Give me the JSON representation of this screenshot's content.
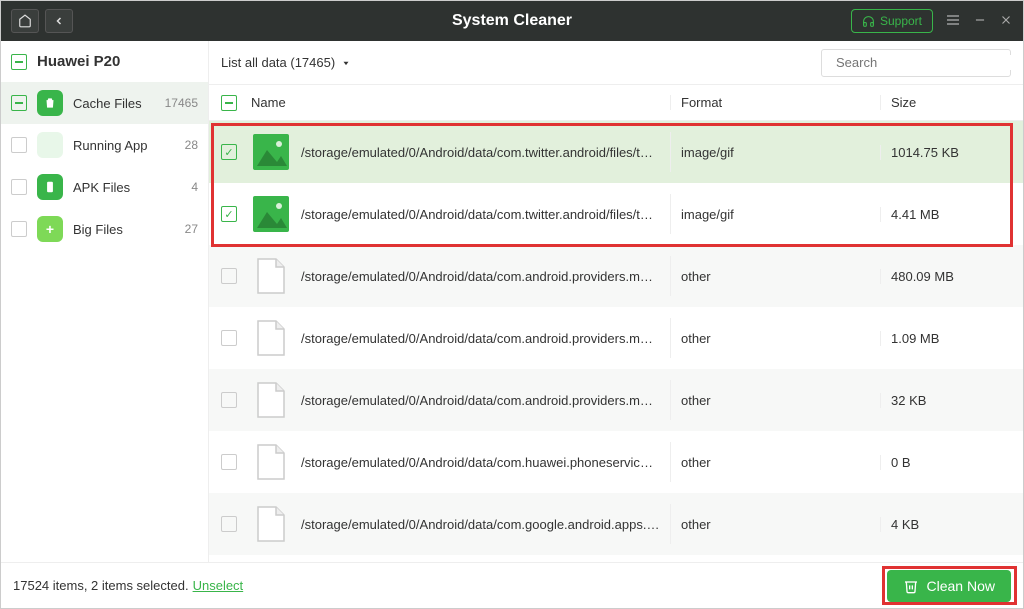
{
  "titlebar": {
    "title": "System Cleaner",
    "support": "Support"
  },
  "sidebar": {
    "device": "Huawei P20",
    "categories": [
      {
        "label": "Cache Files",
        "count": "17465",
        "active": true,
        "checked": "partial"
      },
      {
        "label": "Running App",
        "count": "28",
        "active": false,
        "checked": "none"
      },
      {
        "label": "APK Files",
        "count": "4",
        "active": false,
        "checked": "none"
      },
      {
        "label": "Big Files",
        "count": "27",
        "active": false,
        "checked": "none"
      }
    ]
  },
  "toolbar": {
    "filter": "List all data (17465)",
    "search_placeholder": "Search"
  },
  "table": {
    "headers": {
      "name": "Name",
      "format": "Format",
      "size": "Size"
    },
    "rows": [
      {
        "checked": true,
        "icon": "image",
        "path": "/storage/emulated/0/Android/data/com.twitter.android/files/tmp...",
        "format": "image/gif",
        "size": "1014.75 KB",
        "sel": true
      },
      {
        "checked": true,
        "icon": "image",
        "path": "/storage/emulated/0/Android/data/com.twitter.android/files/tmp...",
        "format": "image/gif",
        "size": "4.41 MB",
        "sel": false
      },
      {
        "checked": false,
        "icon": "doc",
        "path": "/storage/emulated/0/Android/data/com.android.providers.media...",
        "format": "other",
        "size": "480.09 MB",
        "sel": false,
        "alt": true
      },
      {
        "checked": false,
        "icon": "doc",
        "path": "/storage/emulated/0/Android/data/com.android.providers.media...",
        "format": "other",
        "size": "1.09 MB",
        "sel": false
      },
      {
        "checked": false,
        "icon": "doc",
        "path": "/storage/emulated/0/Android/data/com.android.providers.media...",
        "format": "other",
        "size": "32 KB",
        "sel": false,
        "alt": true
      },
      {
        "checked": false,
        "icon": "doc",
        "path": "/storage/emulated/0/Android/data/com.huawei.phoneservice/ca...",
        "format": "other",
        "size": "0 B",
        "sel": false
      },
      {
        "checked": false,
        "icon": "doc",
        "path": "/storage/emulated/0/Android/data/com.google.android.apps.ma...",
        "format": "other",
        "size": "4 KB",
        "sel": false,
        "alt": true
      }
    ]
  },
  "footer": {
    "status": "17524 items, 2 items selected.",
    "unselect": "Unselect",
    "clean": "Clean Now"
  }
}
